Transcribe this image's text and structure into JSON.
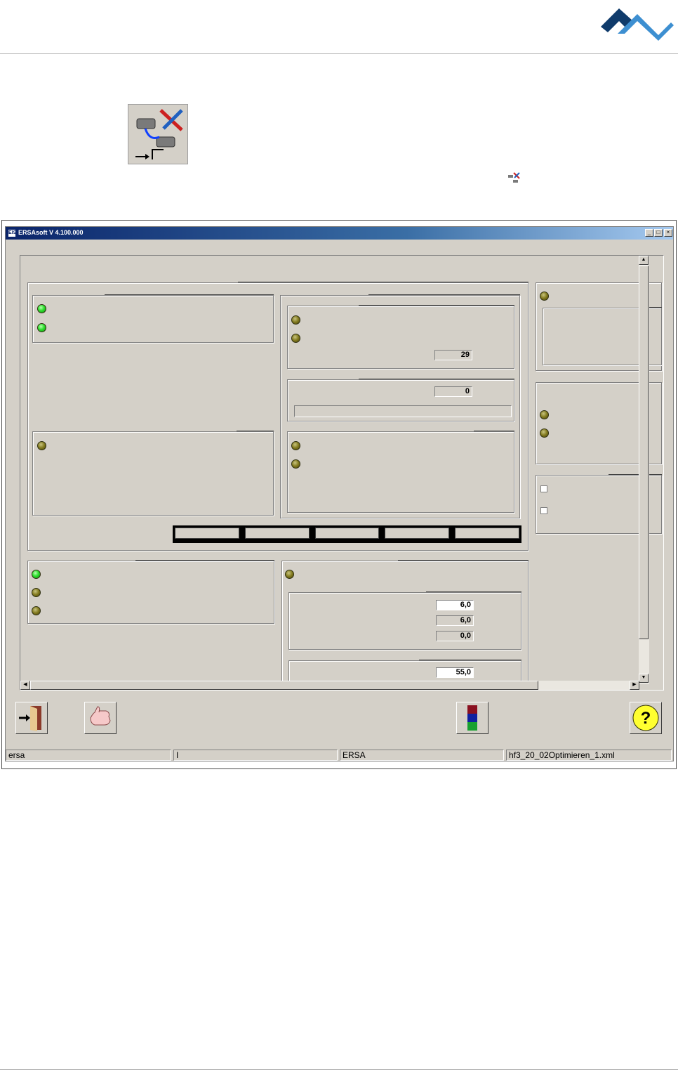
{
  "window": {
    "title": "ERSAsoft V 4.100.000",
    "app_icon": "EIS",
    "minimize": "_",
    "maximize": "□",
    "close": "×"
  },
  "fields": {
    "left_counter": "29",
    "center_counter": "0",
    "value_a": "6,0",
    "value_b": "6,0",
    "value_c": "0,0",
    "value_d": "55,0"
  },
  "toolbar": {
    "exit_icon": "exit-door-icon",
    "confirm_icon": "thumbs-up-icon",
    "colors_icon": "color-stack-icon",
    "help_icon": "help-icon",
    "help_glyph": "?"
  },
  "statusbar": {
    "user": "ersa",
    "mode": "I",
    "profile": "ERSA",
    "file": "hf3_20_02Optimieren_1.xml"
  },
  "colors": {
    "led_on": "#2ee02e",
    "led_off": "#827a1e",
    "face": "#d4d0c8",
    "logo_dark": "#0f3b6b",
    "logo_light": "#3d8fd1"
  }
}
